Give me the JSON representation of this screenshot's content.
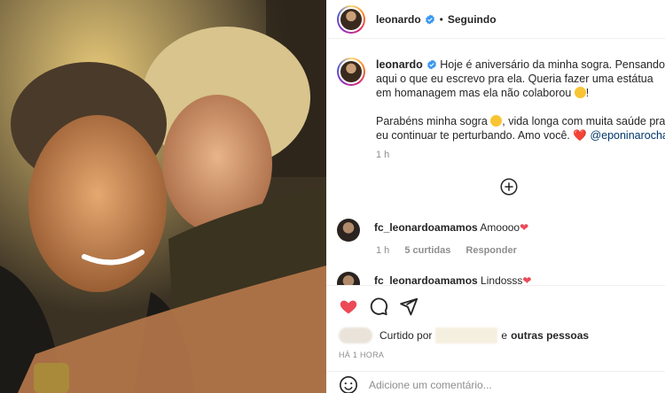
{
  "header": {
    "username": "leonardo",
    "separator": "•",
    "follow_status": "Seguindo"
  },
  "caption": {
    "username": "leonardo",
    "text_part1": " Hoje é aniversário da minha sogra. Pensando aqui o que eu escrevo pra ela. Queria fazer uma estátua em homanagem mas ela não colaborou ",
    "text_part2": "!\n\nParabéns minha sogra ",
    "text_part3": ", vida longa com muita saúde pra eu continuar te perturbando. Amo você. ",
    "heart": "❤️",
    "mention": "@eponinarocha",
    "time": "1 h"
  },
  "comments": [
    {
      "username": "fc_leonardoamamos",
      "text": " Amoooo",
      "heart": "❤",
      "time": "1 h",
      "likes": "5 curtidas",
      "reply": "Responder"
    },
    {
      "username": "fc_leonardoamamos",
      "text": " Lindosss",
      "heart": "❤"
    }
  ],
  "actions": {
    "liked_by_prefix": "Curtido por",
    "liked_by_suffix": "e",
    "others": "outras pessoas",
    "date": "HÁ 1 HORA",
    "add_comment_placeholder": "Adicione um comentário..."
  },
  "colors": {
    "like_red": "#ed4956",
    "mention_blue": "#00376b",
    "verified_blue": "#3897f0",
    "muted_gray": "#8e8e8e"
  }
}
